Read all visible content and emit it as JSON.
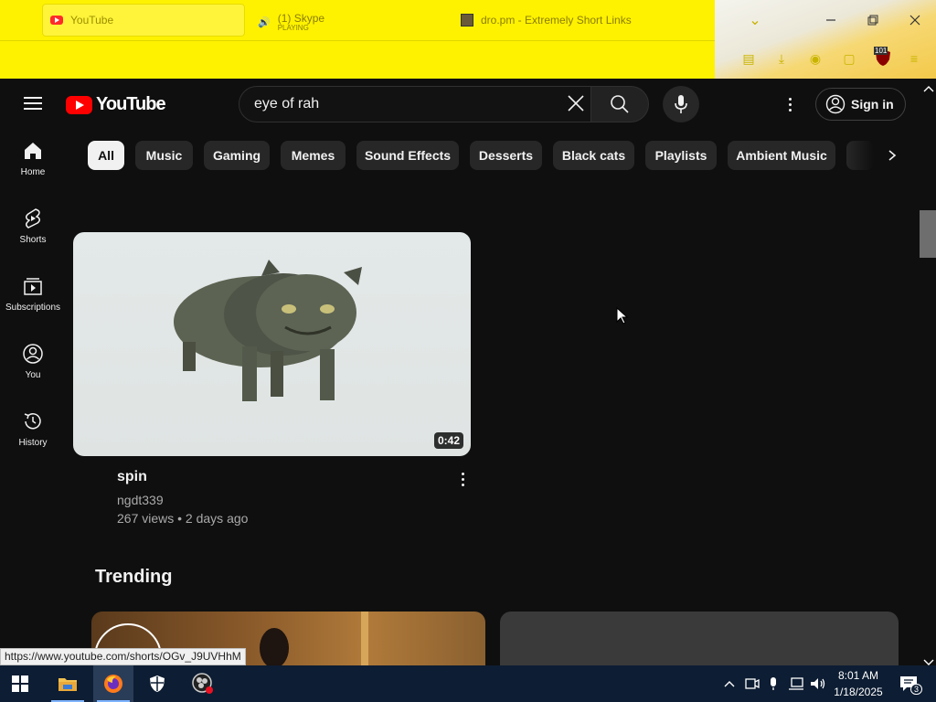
{
  "browser": {
    "tabs": [
      {
        "title": "YouTube",
        "active": true
      },
      {
        "title": "(1) Skype",
        "subtitle": "PLAYING"
      },
      {
        "title": "dro.pm - Extremely Short Links"
      }
    ],
    "extension_badge": "101",
    "status_url": "https://www.youtube.com/shorts/OGv_J9UVHhM"
  },
  "masthead": {
    "logo_text": "YouTube",
    "search_query": "eye of rah",
    "signin_label": "Sign in"
  },
  "sidebar": {
    "items": [
      {
        "label": "Home",
        "icon": "home-icon"
      },
      {
        "label": "Shorts",
        "icon": "shorts-icon"
      },
      {
        "label": "Subscriptions",
        "icon": "subscriptions-icon"
      },
      {
        "label": "You",
        "icon": "you-icon"
      },
      {
        "label": "History",
        "icon": "history-icon"
      }
    ]
  },
  "chips": [
    "All",
    "Music",
    "Gaming",
    "Memes",
    "Sound Effects",
    "Desserts",
    "Black cats",
    "Playlists",
    "Ambient Music"
  ],
  "video": {
    "title": "spin",
    "channel": "ngdt339",
    "meta": "267 views • 2 days ago",
    "duration": "0:42"
  },
  "section": {
    "heading": "Trending"
  },
  "taskbar": {
    "time": "8:01 AM",
    "date": "1/18/2025",
    "notification_count": "3"
  },
  "colors": {
    "browser_theme": "#fff200",
    "yt_red": "#ff0000",
    "yt_bg": "#0f0f0f",
    "chip_bg": "#272727",
    "taskbar": "#0d1d33"
  }
}
